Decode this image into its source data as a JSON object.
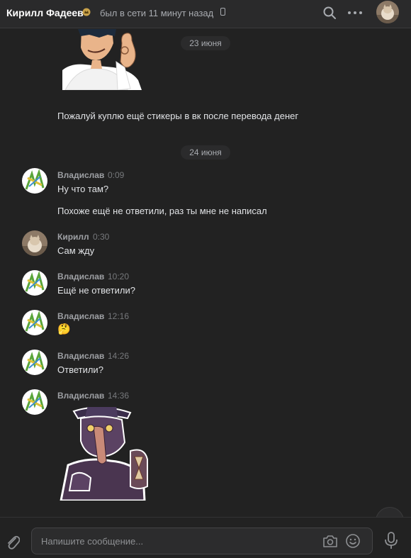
{
  "header": {
    "name": "Кирилл Фадеев",
    "status": "был в сети 11 минут назад"
  },
  "chat": {
    "date1": "23 июня",
    "date2": "24 июня",
    "continued_message": "Пожалуй куплю ещё стикеры в вк после перевода денег",
    "messages": [
      {
        "author": "Владислав",
        "time": "0:09",
        "lines": [
          "Ну что там?",
          "Похоже ещё не ответили, раз ты мне не написал"
        ]
      },
      {
        "author": "Кирилл",
        "time": "0:30",
        "lines": [
          "Сам жду"
        ]
      },
      {
        "author": "Владислав",
        "time": "10:20",
        "lines": [
          "Ещё не ответили?"
        ]
      },
      {
        "author": "Владислав",
        "time": "12:16",
        "emoji": "🤔"
      },
      {
        "author": "Владислав",
        "time": "14:26",
        "lines": [
          "Ответили?"
        ]
      },
      {
        "author": "Владислав",
        "time": "14:36"
      }
    ]
  },
  "composer": {
    "placeholder": "Напишите сообщение..."
  },
  "colors": {
    "background": "#222222",
    "header": "#2a2a2b",
    "text": "#e1e3e6",
    "muted": "#a8abb0"
  }
}
